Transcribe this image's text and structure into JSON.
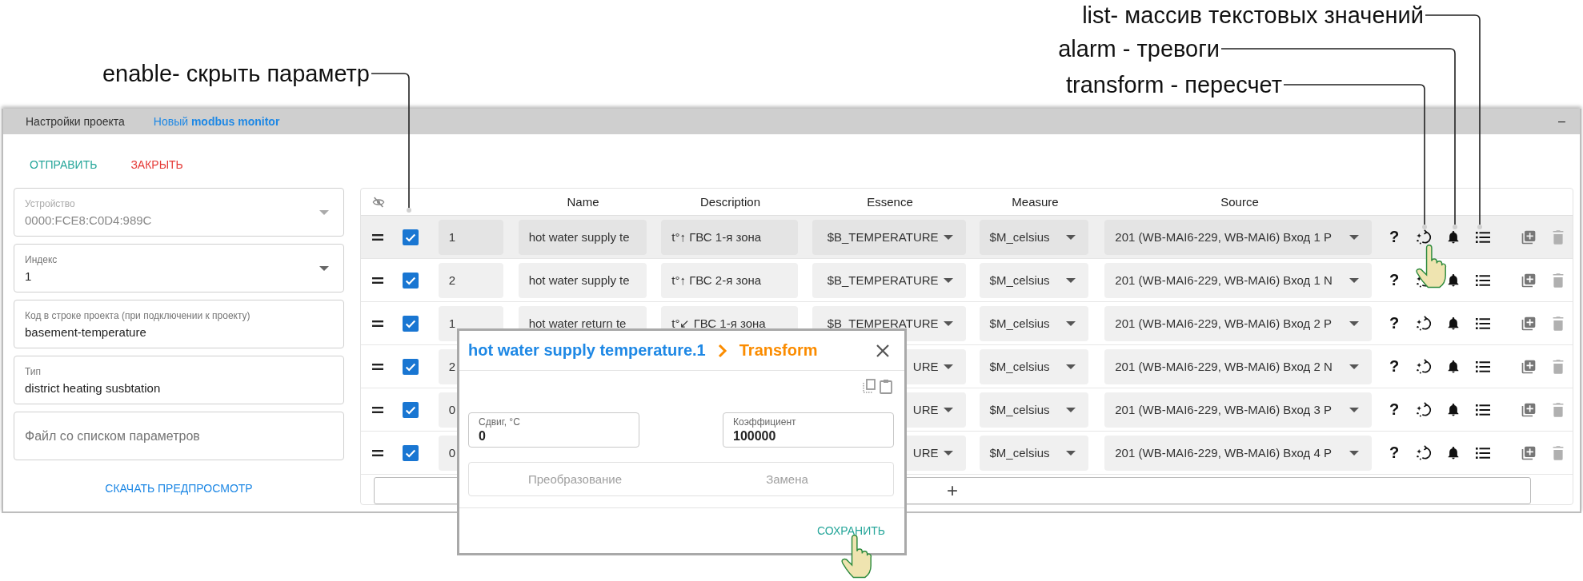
{
  "annotations": [
    {
      "text": "enable- скрыть параметр"
    },
    {
      "text": "list- массив текстовых значений"
    },
    {
      "text": "alarm - тревоги"
    },
    {
      "text": "transform - пересчет"
    }
  ],
  "header": {
    "tabs": [
      {
        "label": "Настройки проекта",
        "selected": false
      },
      {
        "label": "Новый **modbus monitor**",
        "selected": true
      }
    ],
    "minimize": "–"
  },
  "actions": [
    {
      "label": "ОТПРАВИТЬ",
      "kind": "primary"
    },
    {
      "label": "ЗАКРЫТЬ",
      "kind": "danger"
    }
  ],
  "form": {
    "fields": [
      {
        "kind": "select",
        "label": "Устройство",
        "value": "0000:FCE8:C0D4:989C",
        "disabled": true
      },
      {
        "kind": "select",
        "label": "Индекс",
        "value": "1",
        "disabled": false
      },
      {
        "kind": "text",
        "label": "Код в строке проекта (при подключении к проекту)",
        "value": "basement-temperature",
        "disabled": false
      },
      {
        "kind": "text",
        "label": "Тип",
        "value": "district heating susbtation",
        "disabled": false
      },
      {
        "kind": "file",
        "placeholder": "Файл со списком параметров"
      }
    ],
    "download": "СКАЧАТЬ ПРЕДПРОСМОТР"
  },
  "table": {
    "columns": [
      "Name",
      "Description",
      "Essence",
      "Measure",
      "Source"
    ],
    "rows": [
      {
        "enabled": true,
        "hovered": true,
        "index": "1",
        "name": "hot water supply te",
        "description": "t°↑ ГВС 1-я зона",
        "essence": "$B_TEMPERATURE",
        "measure": "$M_celsius",
        "source": "201 (WB-MAI6-229, WB-MAI6) Вход 1 P",
        "help": "?"
      },
      {
        "enabled": true,
        "hovered": false,
        "index": "2",
        "name": "hot water supply te",
        "description": "t°↑ ГВС 2-я зона",
        "essence": "$B_TEMPERATURE",
        "measure": "$M_celsius",
        "source": "201 (WB-MAI6-229, WB-MAI6) Вход 1 N",
        "help": "?"
      },
      {
        "enabled": true,
        "hovered": false,
        "index": "1",
        "name": "hot water return te",
        "description": "t°↙ ГВС 1-я зона",
        "essence": "$B_TEMPERATURE",
        "measure": "$M_celsius",
        "source": "201 (WB-MAI6-229, WB-MAI6) Вход 2 P",
        "help": "?"
      },
      {
        "enabled": true,
        "hovered": false,
        "index": "2",
        "essence": "URE",
        "measure": "$M_celsius",
        "source": "201 (WB-MAI6-229, WB-MAI6) Вход 2 N",
        "help": "?"
      },
      {
        "enabled": true,
        "hovered": false,
        "index": "0",
        "essence": "URE",
        "measure": "$M_celsius",
        "source": "201 (WB-MAI6-229, WB-MAI6) Вход 3 P",
        "help": "?"
      },
      {
        "enabled": true,
        "hovered": false,
        "index": "0",
        "essence": "URE",
        "measure": "$M_celsius",
        "source": "201 (WB-MAI6-229, WB-MAI6) Вход 4 P",
        "help": "?"
      }
    ],
    "add": "+"
  },
  "modal": {
    "title": "hot water supply temperature.1",
    "section": "Transform",
    "fields": [
      {
        "label": "Сдвиг, °C",
        "value": "0"
      },
      {
        "label": "Коэффициент",
        "value": "100000"
      }
    ],
    "modes": [
      {
        "label": "Преобразование",
        "selected": false
      },
      {
        "label": "Замена",
        "selected": false
      }
    ],
    "save": "СОХРАНИТЬ"
  }
}
